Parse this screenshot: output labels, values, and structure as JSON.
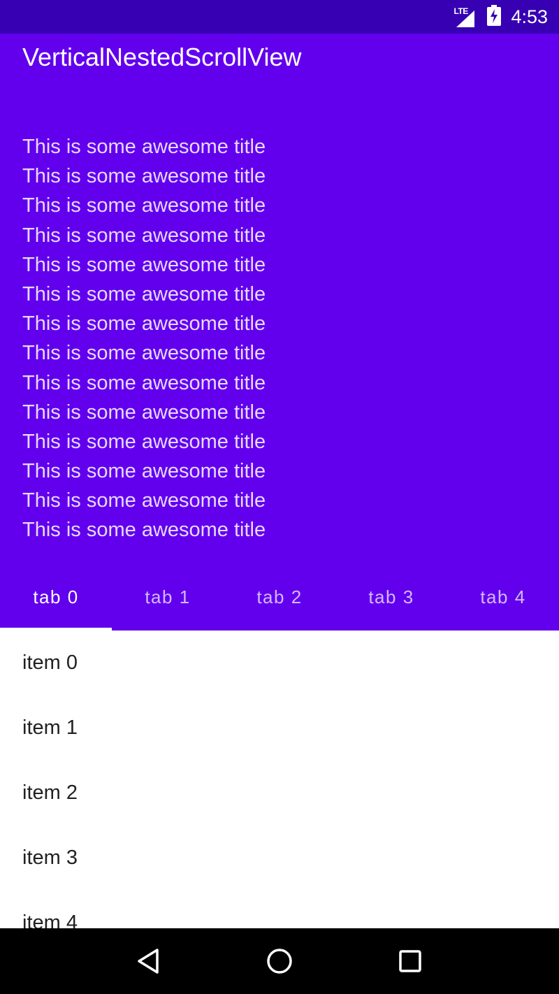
{
  "status_bar": {
    "network_label": "LTE",
    "time": "4:53",
    "icons": [
      "lte-signal-icon",
      "battery-charging-icon"
    ]
  },
  "app_bar": {
    "title": "VerticalNestedScrollView",
    "header_lines": [
      "This is some awesome title",
      "This is some awesome title",
      "This is some awesome title",
      "This is some awesome title",
      "This is some awesome title",
      "This is some awesome title",
      "This is some awesome title",
      "This is some awesome title",
      "This is some awesome title",
      "This is some awesome title",
      "This is some awesome title",
      "This is some awesome title",
      "This is some awesome title",
      "This is some awesome title"
    ],
    "color": "#6200ee",
    "status_color": "#3700b3"
  },
  "tabs": [
    {
      "label": "tab 0",
      "active": true
    },
    {
      "label": "tab 1",
      "active": false
    },
    {
      "label": "tab 2",
      "active": false
    },
    {
      "label": "tab 3",
      "active": false
    },
    {
      "label": "tab 4",
      "active": false
    }
  ],
  "list": {
    "items": [
      "item 0",
      "item 1",
      "item 2",
      "item 3",
      "item 4"
    ]
  },
  "nav_bar": {
    "buttons": [
      "back-icon",
      "home-icon",
      "recents-icon"
    ]
  }
}
